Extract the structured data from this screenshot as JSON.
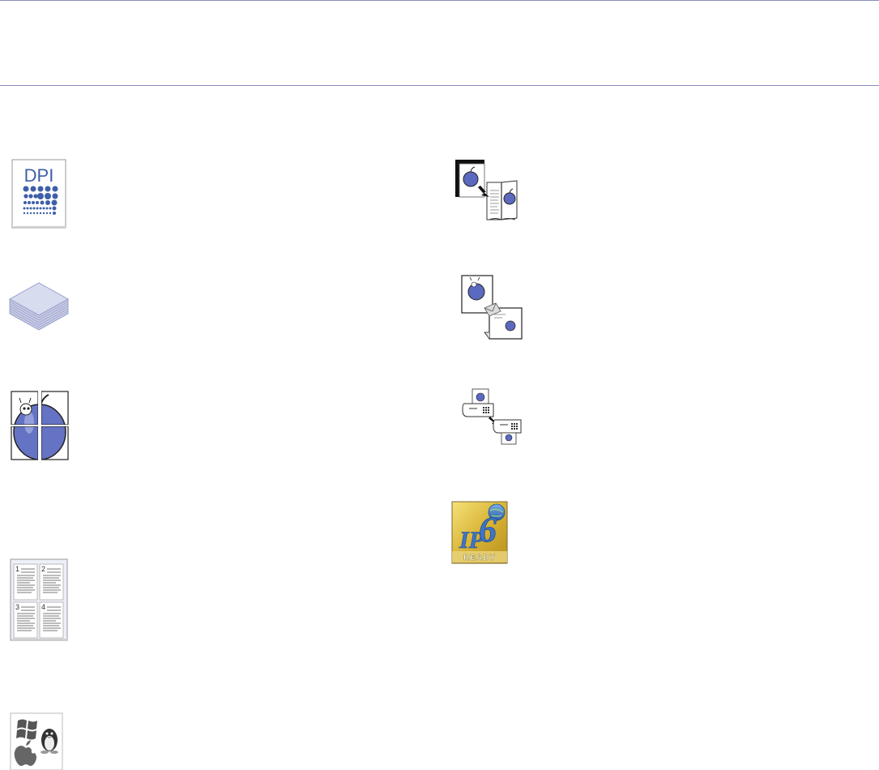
{
  "header": {
    "title": ""
  },
  "features": {
    "left": [
      {
        "icon": "dpi-resolution-icon",
        "text": "DPI"
      },
      {
        "icon": "paper-stack-icon"
      },
      {
        "icon": "poster-print-icon"
      },
      {
        "icon": "multiple-pages-per-sheet-icon",
        "page_numbers": [
          "1",
          "2",
          "3",
          "4"
        ]
      },
      {
        "icon": "operating-systems-icon"
      }
    ],
    "right": [
      {
        "icon": "booklet-print-icon"
      },
      {
        "icon": "watermark-overlay-icon"
      },
      {
        "icon": "fax-icon"
      },
      {
        "icon": "ipv6-ready-logo-icon",
        "logo_text": "READY"
      }
    ]
  },
  "colors": {
    "rule": "#8a8cbf",
    "accent_blue": "#5566b0",
    "dpi_blue": "#3f5fa8"
  }
}
